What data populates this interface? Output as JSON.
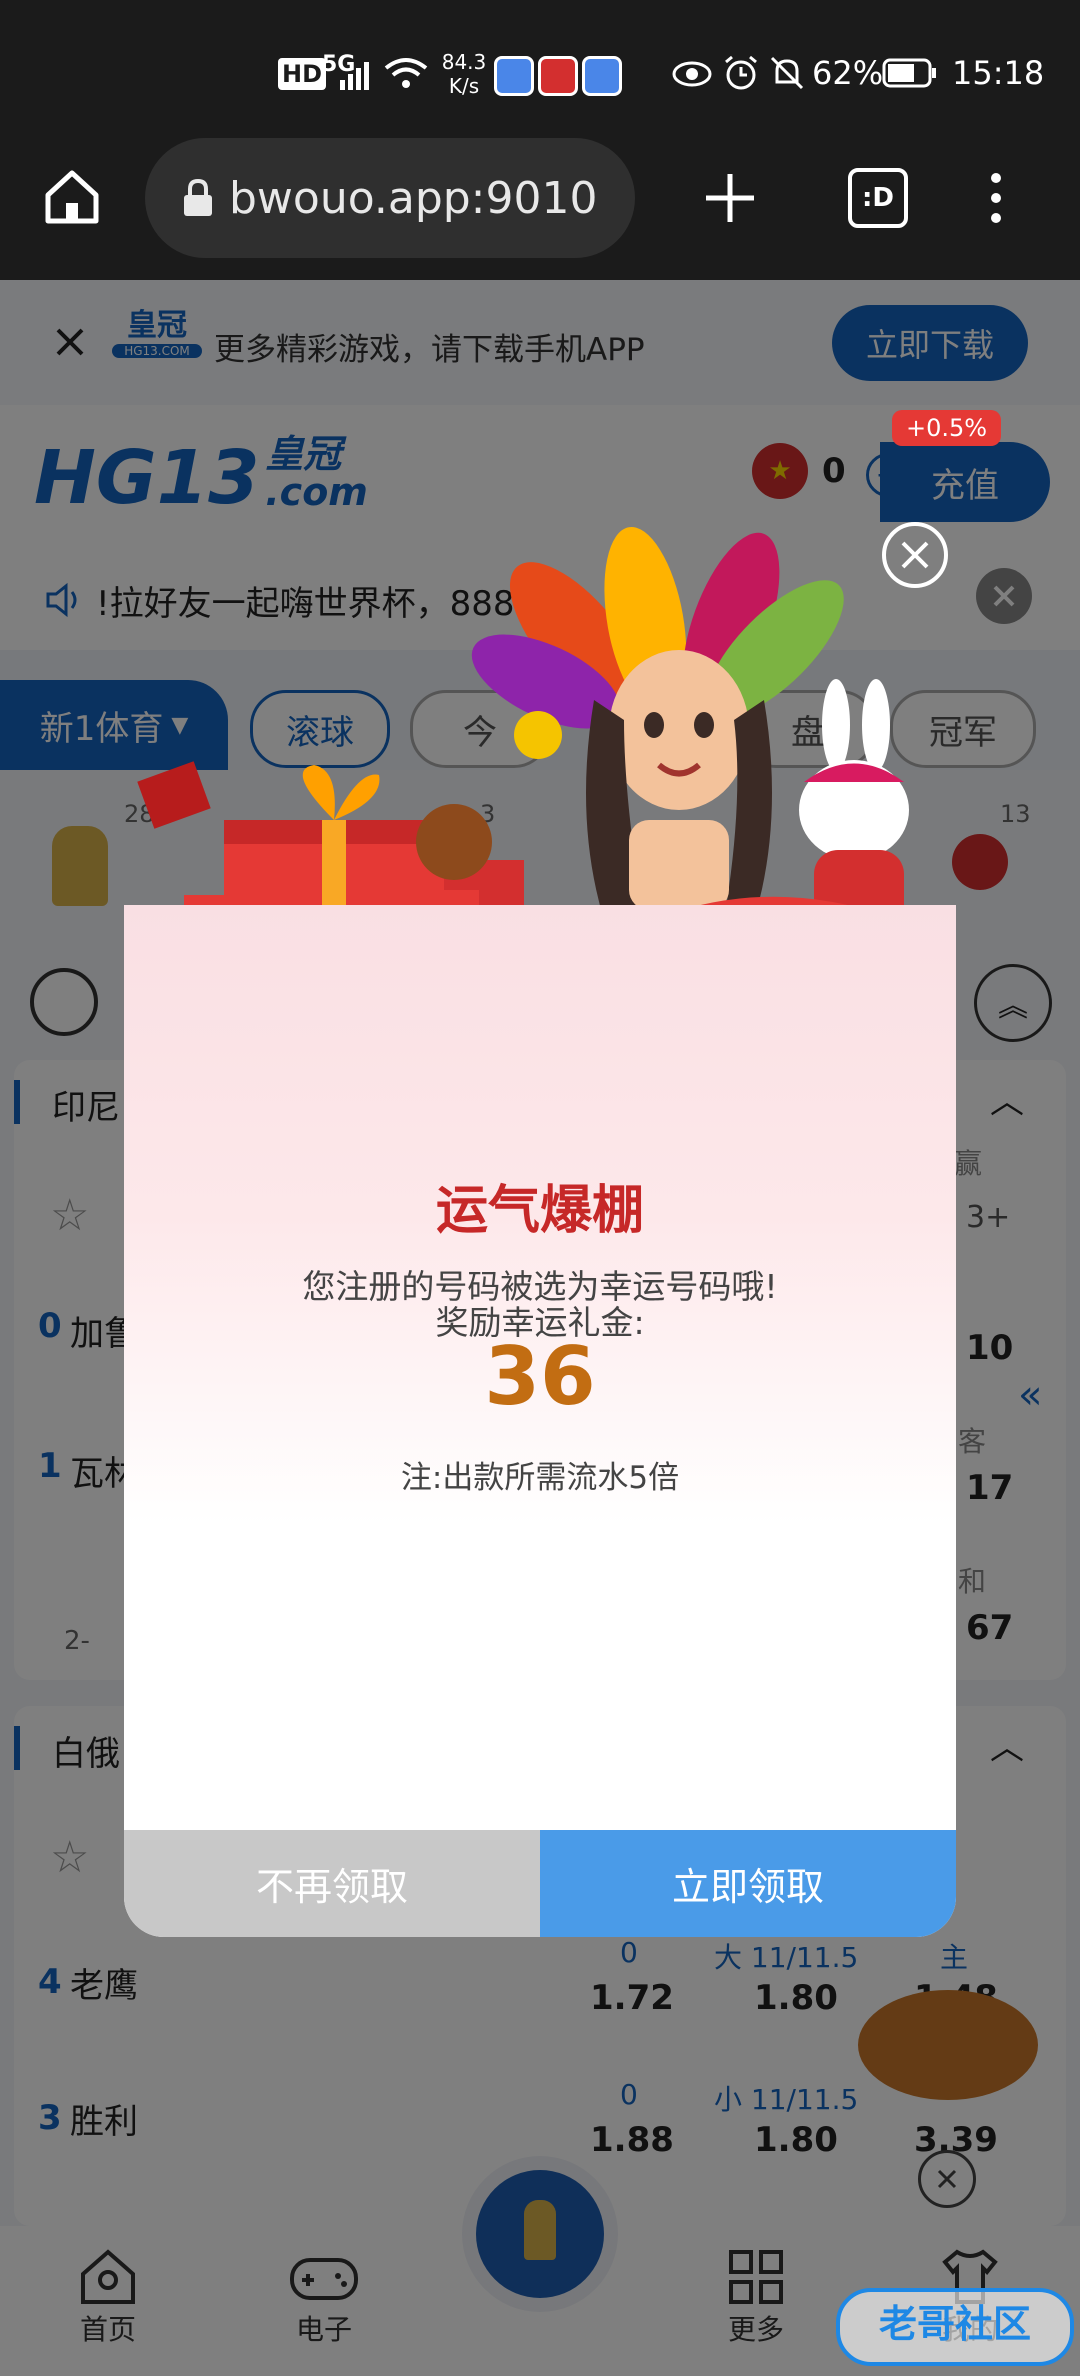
{
  "status_bar": {
    "network_left": "HD",
    "network_type": "5G",
    "speed_value": "84.3",
    "speed_unit": "K/s",
    "battery": "62%",
    "time": "15:18"
  },
  "browser": {
    "url": "bwouo.app:9010",
    "tab_icon_label": ":D"
  },
  "page": {
    "download_banner": {
      "brand": "皇冠",
      "brand_sub": "HG13.COM",
      "text": "更多精彩游戏，请下载手机APP",
      "button": "立即下载"
    },
    "header": {
      "logo_main": "HG13",
      "logo_cn": "皇冠",
      "logo_com": ".com",
      "balance": "0",
      "bonus_badge": "+0.5%",
      "topup_button": "充值"
    },
    "marquee": "!拉好友一起嗨世界杯，8888",
    "marquee_end": "!",
    "tabs": [
      "新1体育",
      "滚球",
      "今",
      "盘",
      "冠军"
    ],
    "sport_counts": [
      "28",
      "3",
      "13"
    ],
    "leagues": [
      {
        "name": "印尼",
        "column_head": "赢",
        "more": "3+",
        "teams": [
          {
            "rank": "0",
            "name": "加鲁",
            "odds": "10"
          },
          {
            "rank": "1",
            "name": "瓦林",
            "odds": "17"
          }
        ],
        "col_labels": [
          "客",
          "和"
        ],
        "extra_odds": "67",
        "footer": "2-"
      },
      {
        "name": "白俄",
        "teams": [
          {
            "rank": "4",
            "name": "老鹰"
          },
          {
            "rank": "3",
            "name": "胜利"
          }
        ],
        "row1": {
          "lbl_a": "0",
          "odd_a": "1.72",
          "lbl_b": "大 11/11.5",
          "odd_b": "1.80",
          "lbl_c": "主",
          "odd_c": "1.48"
        },
        "row2": {
          "lbl_a": "0",
          "odd_a": "1.88",
          "lbl_b": "小 11/11.5",
          "odd_b": "1.80",
          "odd_c": "3.39"
        }
      }
    ],
    "bottom_nav": [
      "首页",
      "电子",
      "更多",
      "我的"
    ],
    "watermark": "老哥社区"
  },
  "modal": {
    "title": "运气爆棚",
    "line1": "您注册的号码被选为幸运号码哦!",
    "line2": "奖励幸运礼金:",
    "amount": "36",
    "note": "注:出款所需流水5倍",
    "btn_decline": "不再领取",
    "btn_accept": "立即领取"
  },
  "colors": {
    "accent": "#1565c0",
    "modal_title": "#c62828",
    "amount": "#c26d12",
    "accept": "#4a9be8",
    "decline": "#c8c8c8"
  }
}
